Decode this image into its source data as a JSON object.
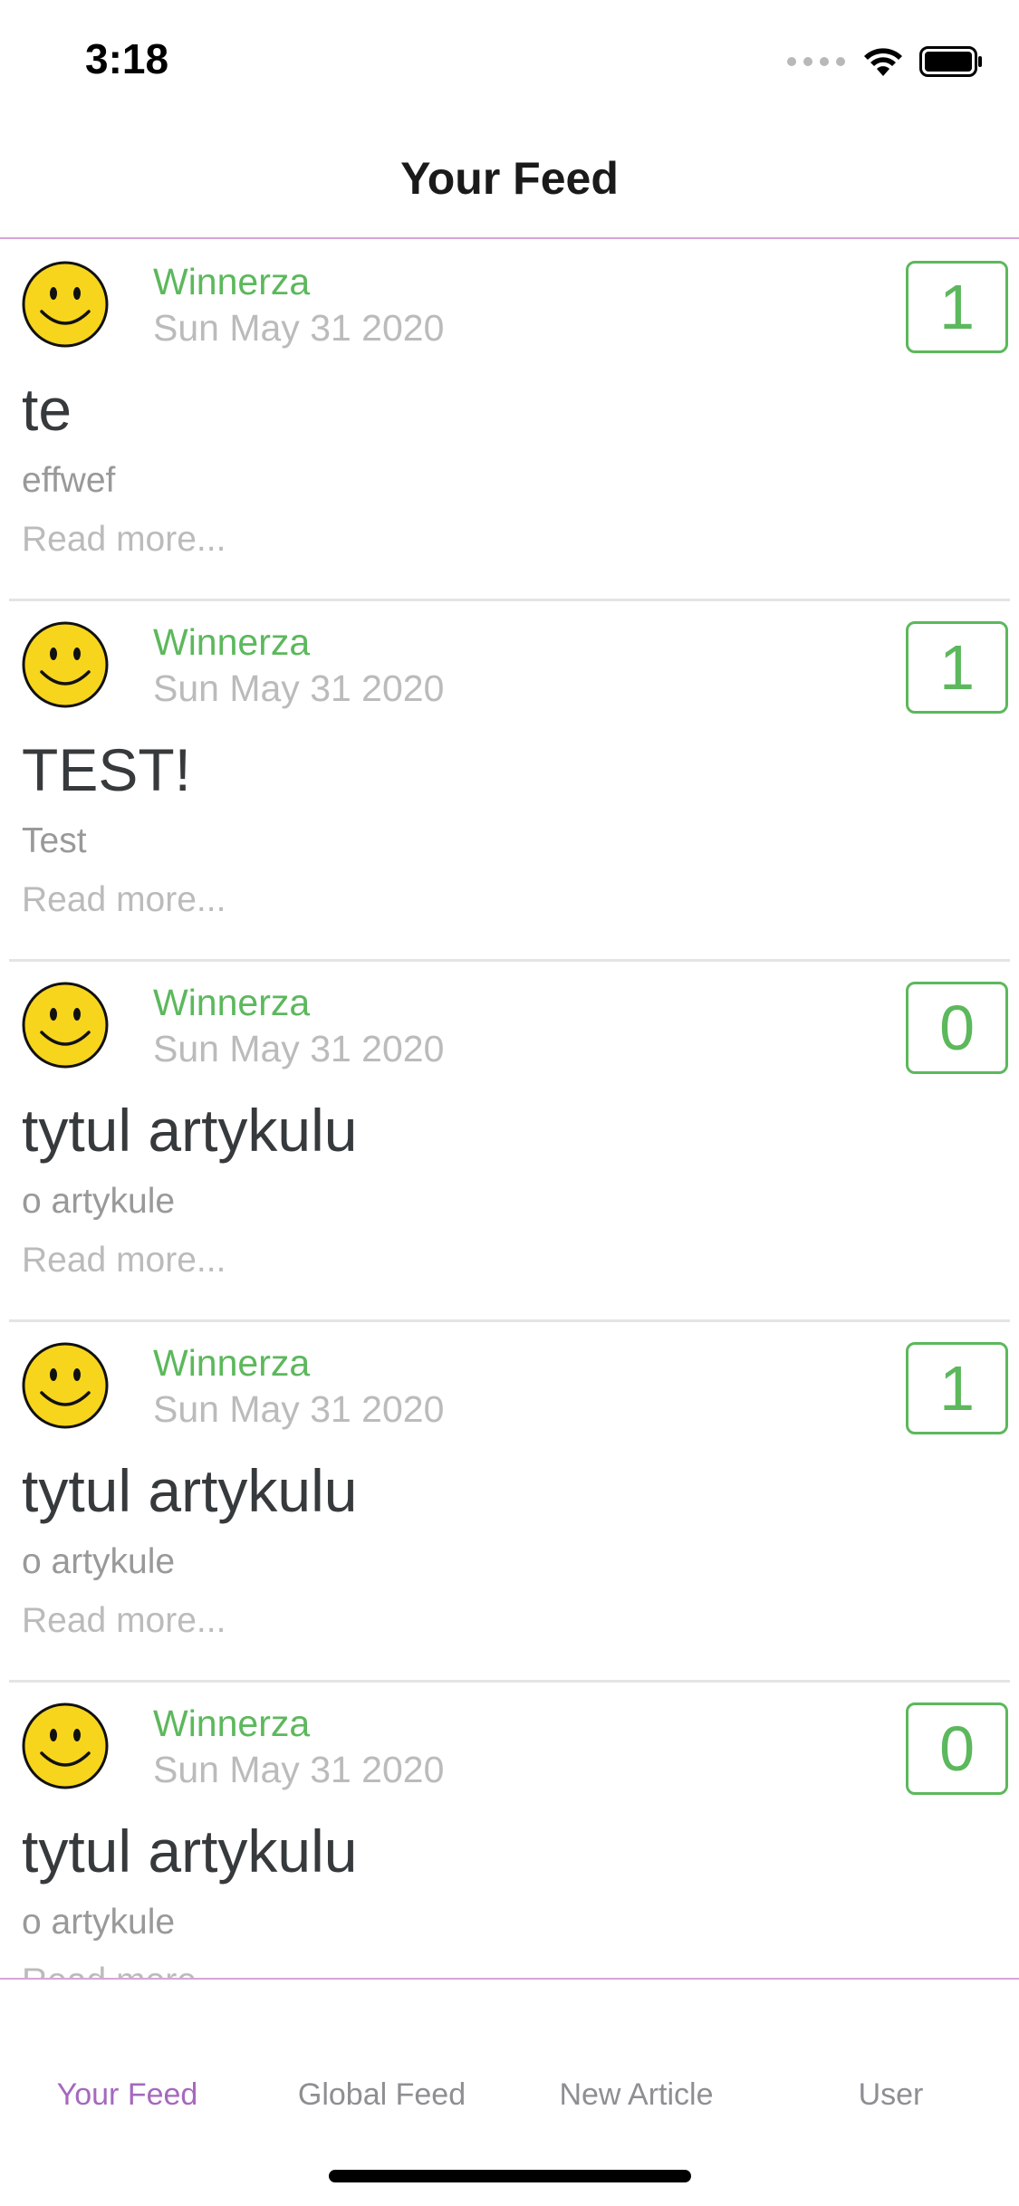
{
  "status_bar": {
    "time": "3:18"
  },
  "nav": {
    "title": "Your Feed"
  },
  "colors": {
    "accent": "#5cb85c",
    "tab_active": "#a569bd",
    "divider": "#d6a6d6"
  },
  "articles": [
    {
      "author": "Winnerza",
      "date": "Sun May 31 2020",
      "likes": "1",
      "title": "te",
      "description": "effwef",
      "read_more": "Read more..."
    },
    {
      "author": "Winnerza",
      "date": "Sun May 31 2020",
      "likes": "1",
      "title": "TEST!",
      "description": "Test",
      "read_more": "Read more..."
    },
    {
      "author": "Winnerza",
      "date": "Sun May 31 2020",
      "likes": "0",
      "title": "tytul artykulu",
      "description": "o artykule",
      "read_more": "Read more..."
    },
    {
      "author": "Winnerza",
      "date": "Sun May 31 2020",
      "likes": "1",
      "title": "tytul artykulu",
      "description": "o artykule",
      "read_more": "Read more..."
    },
    {
      "author": "Winnerza",
      "date": "Sun May 31 2020",
      "likes": "0",
      "title": "tytul artykulu",
      "description": "o artykule",
      "read_more": "Read more..."
    }
  ],
  "tabs": [
    {
      "label": "Your Feed",
      "active": true
    },
    {
      "label": "Global Feed",
      "active": false
    },
    {
      "label": "New Article",
      "active": false
    },
    {
      "label": "User",
      "active": false
    }
  ]
}
